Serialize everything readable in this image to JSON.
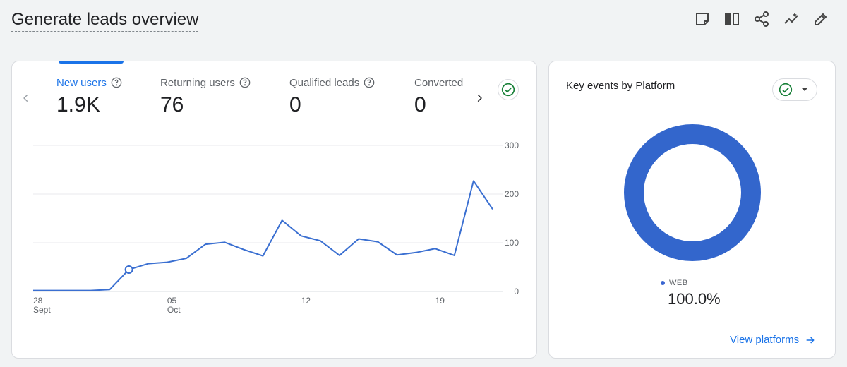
{
  "header": {
    "title": "Generate leads overview",
    "toolbar": [
      {
        "icon": "note-icon"
      },
      {
        "icon": "compare-icon"
      },
      {
        "icon": "share-icon"
      },
      {
        "icon": "insights-icon"
      },
      {
        "icon": "edit-icon"
      }
    ]
  },
  "metrics": [
    {
      "label": "New users",
      "value": "1.9K",
      "active": true
    },
    {
      "label": "Returning users",
      "value": "76",
      "active": false
    },
    {
      "label": "Qualified leads",
      "value": "0",
      "active": false
    },
    {
      "label": "Converted",
      "value": "0",
      "active": false
    }
  ],
  "colors": {
    "accent": "#1a73e8",
    "line": "#3a6fd1",
    "donut": "#3366cc"
  },
  "chart_data": {
    "type": "line",
    "x": [
      "Sep 28",
      "Sep 29",
      "Sep 30",
      "Oct 01",
      "Oct 02",
      "Oct 03",
      "Oct 04",
      "Oct 05",
      "Oct 06",
      "Oct 07",
      "Oct 08",
      "Oct 09",
      "Oct 10",
      "Oct 11",
      "Oct 12",
      "Oct 13",
      "Oct 14",
      "Oct 15",
      "Oct 16",
      "Oct 17",
      "Oct 18",
      "Oct 19",
      "Oct 20",
      "Oct 21",
      "Oct 22"
    ],
    "series": [
      {
        "values": [
          2,
          2,
          2,
          2,
          4,
          45,
          57,
          60,
          68,
          97,
          101,
          86,
          73,
          146,
          114,
          104,
          74,
          108,
          102,
          75,
          80,
          88,
          74,
          227,
          169
        ]
      }
    ],
    "highlight_index": 5,
    "xticks": [
      {
        "index": 0,
        "label": "28",
        "sublabel": "Sept"
      },
      {
        "index": 7,
        "label": "05",
        "sublabel": "Oct"
      },
      {
        "index": 14,
        "label": "12",
        "sublabel": ""
      },
      {
        "index": 21,
        "label": "19",
        "sublabel": ""
      }
    ],
    "yticks": [
      "0",
      "100",
      "200",
      "300"
    ],
    "ylim": [
      0,
      300
    ],
    "grid": true
  },
  "side": {
    "title_part1": "Key events",
    "title_part2": "by",
    "title_part3": "Platform",
    "donut": {
      "slices": [
        {
          "label": "WEB",
          "value": 100.0
        }
      ]
    },
    "legend_label": "WEB",
    "legend_value": "100.0%",
    "link": "View platforms"
  }
}
